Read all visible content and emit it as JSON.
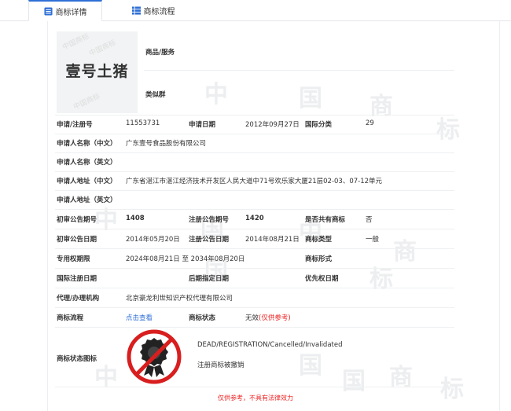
{
  "tabs": [
    {
      "label": "商标详情",
      "icon": "list-icon"
    },
    {
      "label": "商标流程",
      "icon": "flow-icon"
    }
  ],
  "logo": {
    "text": "壹号土猪"
  },
  "goods_label": "商品/服务",
  "similar_label": "类似群",
  "fields": {
    "reg_no_label": "申请/注册号",
    "reg_no": "11553731",
    "apply_date_label": "申请日期",
    "apply_date": "2012年09月27日",
    "intl_class_label": "国际分类",
    "intl_class": "29",
    "applicant_cn_label": "申请人名称（中文）",
    "applicant_cn": "广东壹号食品股份有限公司",
    "applicant_en_label": "申请人名称（英文）",
    "address_cn_label": "申请人地址（中文）",
    "address_cn": "广东省湛江市湛江经济技术开发区人民大道中71号欢乐家大厦21层02-03、07-12单元",
    "address_en_label": "申请人地址（英文）",
    "prelim_no_label": "初审公告期号",
    "prelim_no": "1408",
    "reg_notice_no_label": "注册公告期号",
    "reg_notice_no": "1420",
    "shared_label": "是否共有商标",
    "shared": "否",
    "prelim_date_label": "初审公告日期",
    "prelim_date": "2014年05月20日",
    "reg_notice_date_label": "注册公告日期",
    "reg_notice_date": "2014年08月21日",
    "tm_type_label": "商标类型",
    "tm_type": "一般",
    "exclusive_label": "专用权期限",
    "exclusive": "2024年08月21日 至 2034年08月20日",
    "tm_form_label": "商标形式",
    "intl_reg_date_label": "国际注册日期",
    "later_date_label": "后期指定日期",
    "priority_label": "优先权日期",
    "agent_label": "代理/办理机构",
    "agent": "北京豪龙利世知识产权代理有限公司",
    "process_label": "商标流程",
    "process_link": "点击查看",
    "status_label": "商标状态",
    "status_value": "无效",
    "status_note": "(仅供参考)",
    "status_icon_label": "商标状态图标",
    "status_en": "DEAD/REGISTRATION/Cancelled/Invalidated",
    "status_cn": "注册商标被撤销"
  },
  "disclaimer": "仅供参考，不具有法律效力",
  "colors": {
    "accent": "#2f6fd6",
    "red": "#e22"
  }
}
